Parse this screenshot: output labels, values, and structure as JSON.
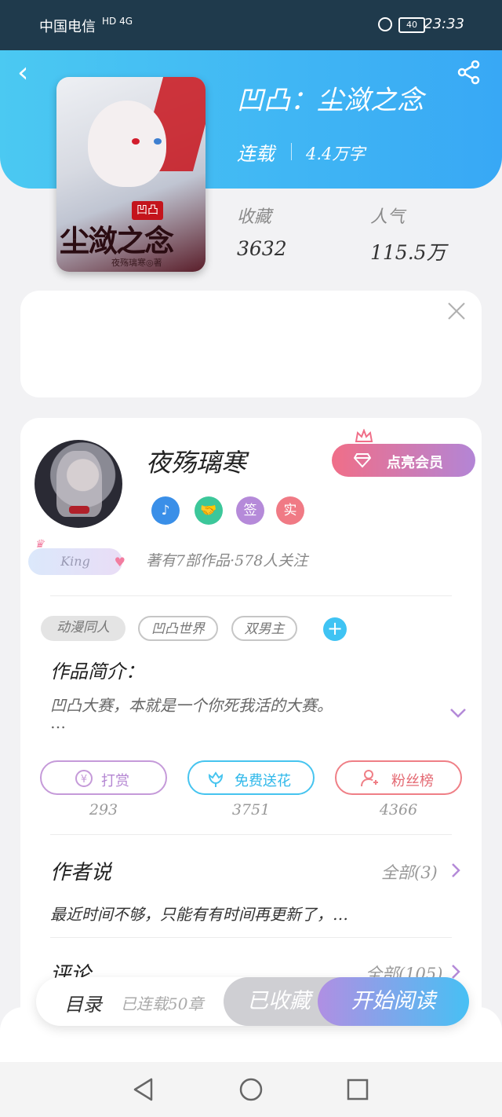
{
  "status_bar": {
    "carrier": "中国电信",
    "network": "HD 4G",
    "battery": "40",
    "time": "23:33"
  },
  "book": {
    "cover_stamp": "凹凸",
    "cover_title": "尘潋之念",
    "cover_author": "夜殇璃寒◎著",
    "title": "凹凸：尘潋之念",
    "status": "连载",
    "word_count": "4.4万字",
    "stats": [
      {
        "label": "收藏",
        "value": "3632"
      },
      {
        "label": "人气",
        "value": "115.5万"
      }
    ]
  },
  "author": {
    "name": "夜殇璃寒",
    "vip_button": "点亮会员",
    "badges": [
      {
        "text": "♪",
        "color": "#3a8fe8"
      },
      {
        "text": "🤝",
        "color": "#3cc79a"
      },
      {
        "text": "签",
        "color": "#b58ad9"
      },
      {
        "text": "实",
        "color": "#f07a85"
      }
    ],
    "title_badge": "King",
    "meta": "著有7部作品·578人关注"
  },
  "tags": [
    "动漫同人",
    "凹凸世界",
    "双男主"
  ],
  "intro": {
    "heading": "作品简介：",
    "text": "凹凸大赛，本就是一个你死我活的大赛。",
    "ellipsis": "…"
  },
  "actions": [
    {
      "label": "打赏",
      "count": "293",
      "color": "#c59ad9"
    },
    {
      "label": "免费送花",
      "count": "3751",
      "color": "#46c4ef"
    },
    {
      "label": "粉丝榜",
      "count": "4366",
      "color": "#ef7f86"
    }
  ],
  "author_says": {
    "title": "作者说",
    "more": "全部(3)",
    "text": "最近时间不够，只能有有时间再更新了，…"
  },
  "comments": {
    "title": "评论",
    "more": "全部(105)"
  },
  "bottom_bar": {
    "toc": "目录",
    "chapters": "已连载50章",
    "collected": "已收藏",
    "read": "开始阅读"
  },
  "colors": {
    "accent_blue": "#38a8f5",
    "vip_pink": "#f06e88",
    "vip_purple": "#b385d6"
  }
}
